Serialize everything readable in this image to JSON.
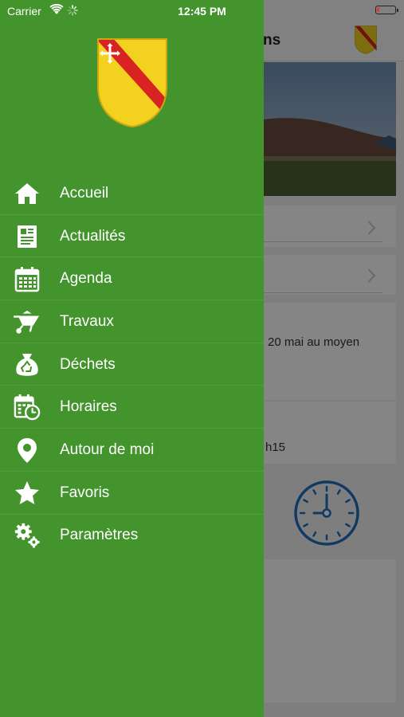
{
  "status_bar": {
    "carrier": "Carrier",
    "time": "12:45 PM"
  },
  "background": {
    "title_fragment": "ns",
    "text_date": "20 mai au moyen",
    "text_time": "h15"
  },
  "drawer": {
    "background_color": "#43942c",
    "items": [
      {
        "label": "Accueil",
        "icon": "home-icon"
      },
      {
        "label": "Actualités",
        "icon": "newspaper-icon"
      },
      {
        "label": "Agenda",
        "icon": "calendar-icon"
      },
      {
        "label": "Travaux",
        "icon": "wheelbarrow-icon"
      },
      {
        "label": "Déchets",
        "icon": "recycle-bag-icon"
      },
      {
        "label": "Horaires",
        "icon": "calendar-clock-icon"
      },
      {
        "label": "Autour de moi",
        "icon": "map-pin-icon"
      },
      {
        "label": "Favoris",
        "icon": "star-icon"
      },
      {
        "label": "Paramètres",
        "icon": "gears-icon"
      }
    ]
  }
}
